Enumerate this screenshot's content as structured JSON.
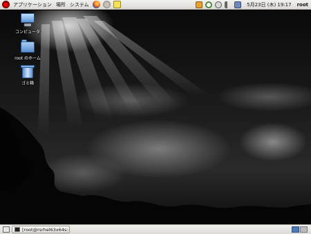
{
  "top_panel": {
    "menus": [
      {
        "label": "アプリケーション",
        "name": "menu-applications"
      },
      {
        "label": "場所",
        "name": "menu-places"
      },
      {
        "label": "システム",
        "name": "menu-system"
      }
    ],
    "clock": "5月23日 (木) 19:17",
    "user": "root"
  },
  "desktop": {
    "icons": [
      {
        "label": "コンピュータ",
        "name": "computer"
      },
      {
        "label": "root のホーム",
        "name": "home"
      },
      {
        "label": "ゴミ箱",
        "name": "trash"
      }
    ]
  },
  "bottom_panel": {
    "task": "[root@rsrhel63x64s:~"
  }
}
